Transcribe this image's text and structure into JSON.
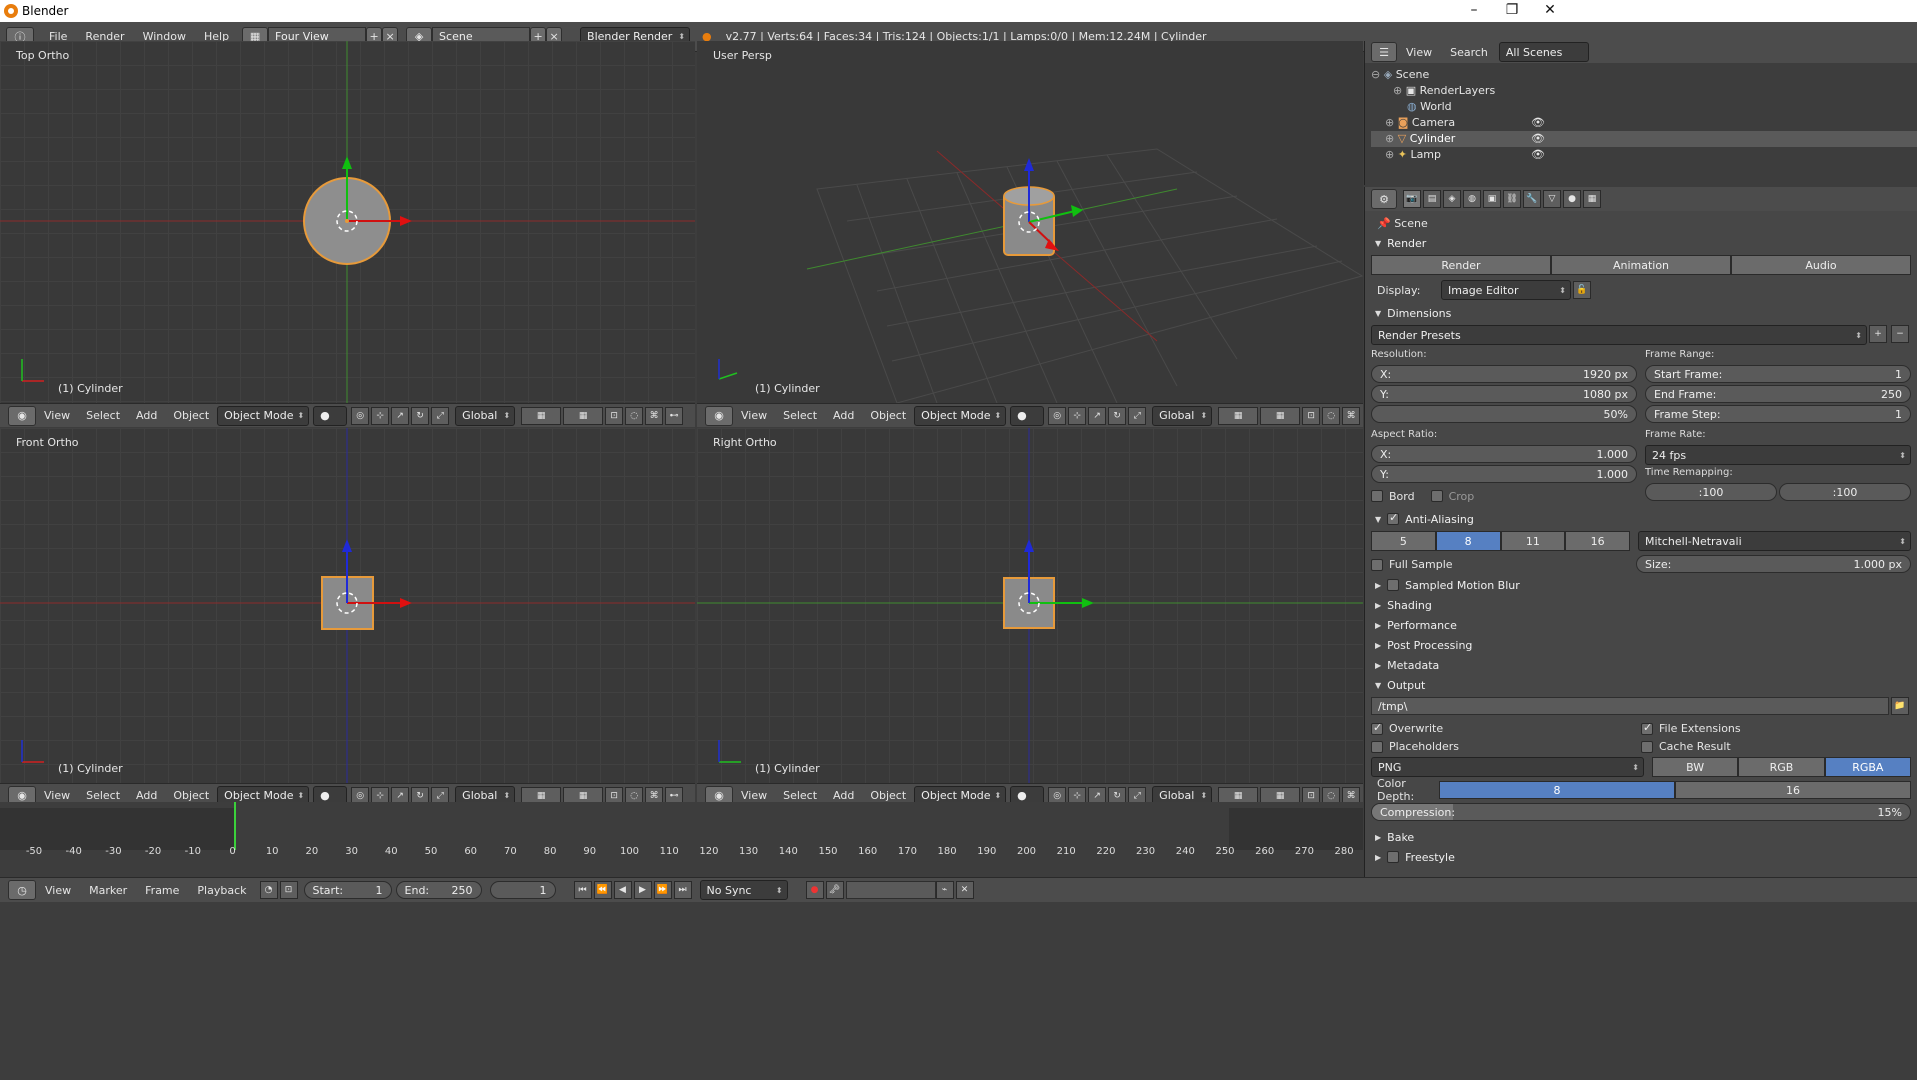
{
  "window": {
    "title": "Blender"
  },
  "infobar": {
    "menus": [
      "File",
      "Render",
      "Window",
      "Help"
    ],
    "screen_layout": "Four View",
    "scene": "Scene",
    "engine": "Blender Render",
    "stats": "v2.77 | Verts:64 | Faces:34 | Tris:124 | Objects:1/1 | Lamps:0/0 | Mem:12.24M | Cylinder"
  },
  "viewports": [
    {
      "label": "Top Ortho",
      "object": "(1) Cylinder"
    },
    {
      "label": "User Persp",
      "object": "(1) Cylinder"
    },
    {
      "label": "Front Ortho",
      "object": "(1) Cylinder"
    },
    {
      "label": "Right Ortho",
      "object": "(1) Cylinder"
    }
  ],
  "viewport_header": {
    "menus": [
      "View",
      "Select",
      "Add",
      "Object"
    ],
    "mode": "Object Mode",
    "orientation": "Global"
  },
  "outliner": {
    "header": {
      "view": "View",
      "search": "Search",
      "filter": "All Scenes"
    },
    "items": [
      "Scene",
      "RenderLayers",
      "World",
      "Camera",
      "Cylinder",
      "Lamp"
    ]
  },
  "properties": {
    "context": "Scene",
    "render_panel": "Render",
    "render_buttons": [
      "Render",
      "Animation",
      "Audio"
    ],
    "display_label": "Display:",
    "display_value": "Image Editor",
    "dimensions": "Dimensions",
    "presets": "Render Presets",
    "resolution_label": "Resolution:",
    "res_x": "1920 px",
    "res_y": "1080 px",
    "res_pct": "50%",
    "frame_range_label": "Frame Range:",
    "start_frame": "1",
    "end_frame": "250",
    "frame_step": "1",
    "aspect_label": "Aspect Ratio:",
    "aspect_x": "1.000",
    "aspect_y": "1.000",
    "frame_rate_label": "Frame Rate:",
    "frame_rate": "24 fps",
    "time_remap_label": "Time Remapping:",
    "remap_old": ":100",
    "remap_new": ":100",
    "bord": "Bord",
    "crop": "Crop",
    "aa": "Anti-Aliasing",
    "aa_samples": [
      "5",
      "8",
      "11",
      "16"
    ],
    "aa_filter": "Mitchell-Netravali",
    "full_sample": "Full Sample",
    "aa_size": "1.000 px",
    "collapsed": [
      "Sampled Motion Blur",
      "Shading",
      "Performance",
      "Post Processing",
      "Metadata"
    ],
    "output": "Output",
    "output_path": "/tmp\\",
    "overwrite": "Overwrite",
    "file_ext": "File Extensions",
    "placeholders": "Placeholders",
    "cache": "Cache Result",
    "format": "PNG",
    "color_modes": [
      "BW",
      "RGB",
      "RGBA"
    ],
    "color_depth_label": "Color Depth:",
    "depth_8": "8",
    "depth_16": "16",
    "compression_label": "Compression:",
    "compression": "15%",
    "bake": "Bake",
    "freestyle": "Freestyle"
  },
  "timeline": {
    "ticks": [
      "-50",
      "-40",
      "-30",
      "-20",
      "-10",
      "0",
      "10",
      "20",
      "30",
      "40",
      "50",
      "60",
      "70",
      "80",
      "90",
      "100",
      "110",
      "120",
      "130",
      "140",
      "150",
      "160",
      "170",
      "180",
      "190",
      "200",
      "210",
      "220",
      "230",
      "240",
      "250",
      "260",
      "270",
      "280"
    ],
    "menus": [
      "View",
      "Marker",
      "Frame",
      "Playback"
    ],
    "start_label": "Start:",
    "start": "1",
    "end_label": "End:",
    "end": "250",
    "current": "1",
    "sync": "No Sync"
  }
}
